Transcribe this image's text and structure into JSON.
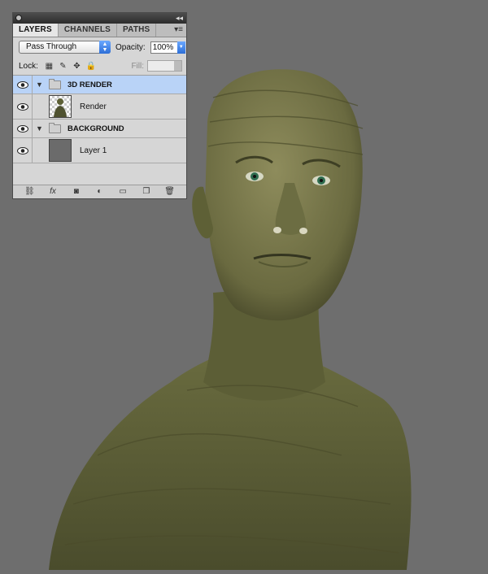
{
  "panel": {
    "tabs": [
      {
        "label": "LAYERS",
        "active": true
      },
      {
        "label": "CHANNELS",
        "active": false
      },
      {
        "label": "PATHS",
        "active": false
      }
    ],
    "blend_mode": "Pass Through",
    "opacity_label": "Opacity:",
    "opacity_value": "100%",
    "lock_label": "Lock:",
    "fill_label": "Fill:",
    "layers": [
      {
        "name": "3D RENDER",
        "type": "group",
        "selected": true
      },
      {
        "name": "Render",
        "type": "layer"
      },
      {
        "name": "BACKGROUND",
        "type": "group"
      },
      {
        "name": "Layer 1",
        "type": "layer"
      }
    ],
    "bottom_icons": [
      "link-icon",
      "fx-icon",
      "mask-icon",
      "adjustment-icon",
      "new-group-icon",
      "new-layer-icon",
      "trash-icon"
    ],
    "colors": {
      "selected": "#b9d3f7",
      "accent": "#2d6ed6"
    }
  },
  "canvas": {
    "background": "#6e6e6e",
    "subject": "3D textured wooden human figure"
  }
}
